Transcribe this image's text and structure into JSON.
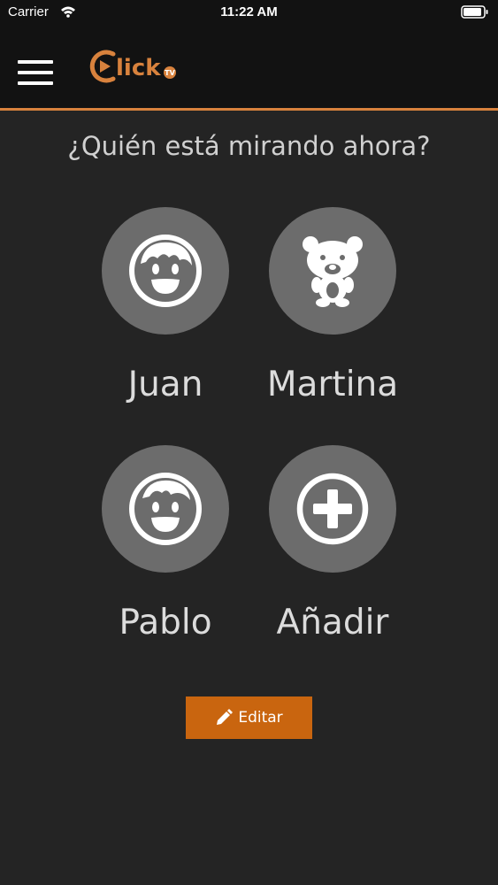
{
  "status_bar": {
    "carrier": "Carrier",
    "time": "11:22 AM",
    "wifi_icon": "wifi-icon",
    "battery_icon": "battery-icon"
  },
  "header": {
    "menu_icon": "hamburger-menu-icon",
    "logo_text": "lick",
    "logo_badge": "TV",
    "accent_color": "#d8823d"
  },
  "title": "¿Quién está mirando ahora?",
  "profiles": [
    {
      "name": "Juan",
      "icon": "boy-face-icon"
    },
    {
      "name": "Martina",
      "icon": "teddy-bear-icon"
    },
    {
      "name": "Pablo",
      "icon": "boy-face-icon"
    },
    {
      "name": "Añadir",
      "icon": "plus-circle-icon"
    }
  ],
  "edit_button": {
    "label": "Editar",
    "icon": "pencil-icon",
    "color": "#c9650f"
  }
}
